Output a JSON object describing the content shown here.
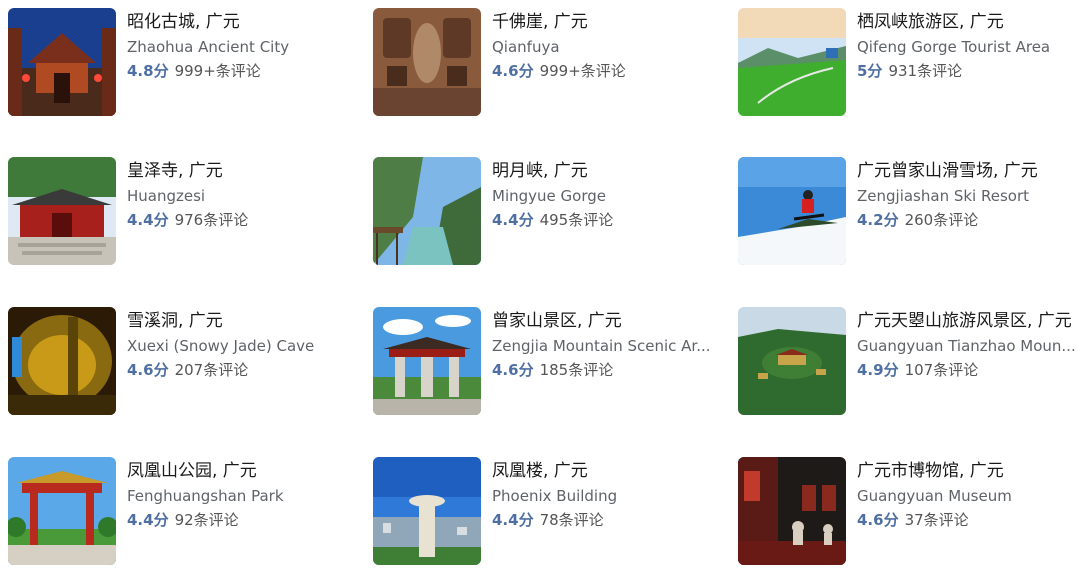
{
  "attractions": [
    {
      "title": "昭化古城, 广元",
      "subtitle": "Zhaohua Ancient City",
      "score": "4.8分",
      "reviews": "999+条评论",
      "thumb_icon": "ancient-city-photo-icon"
    },
    {
      "title": "千佛崖, 广元",
      "subtitle": "Qianfuya",
      "score": "4.6分",
      "reviews": "999+条评论",
      "thumb_icon": "cliff-carving-photo-icon"
    },
    {
      "title": "栖凤峡旅游区, 广元",
      "subtitle": "Qifeng Gorge Tourist Area",
      "score": "5分",
      "reviews": "931条评论",
      "thumb_icon": "gorge-meadow-photo-icon"
    },
    {
      "title": "皇泽寺, 广元",
      "subtitle": "Huangzesi",
      "score": "4.4分",
      "reviews": "976条评论",
      "thumb_icon": "temple-photo-icon"
    },
    {
      "title": "明月峡, 广元",
      "subtitle": "Mingyue Gorge",
      "score": "4.4分",
      "reviews": "495条评论",
      "thumb_icon": "river-gorge-photo-icon"
    },
    {
      "title": "广元曾家山滑雪场, 广元",
      "subtitle": "Zengjiashan Ski Resort",
      "score": "4.2分",
      "reviews": "260条评论",
      "thumb_icon": "skier-photo-icon"
    },
    {
      "title": "雪溪洞, 广元",
      "subtitle": "Xuexi (Snowy Jade) Cave",
      "score": "4.6分",
      "reviews": "207条评论",
      "thumb_icon": "cave-photo-icon"
    },
    {
      "title": "曾家山景区, 广元",
      "subtitle": "Zengjia Mountain Scenic Ar...",
      "score": "4.6分",
      "reviews": "185条评论",
      "thumb_icon": "gate-arch-photo-icon"
    },
    {
      "title": "广元天曌山旅游风景区, 广元",
      "subtitle": "Guangyuan Tianzhao Moun...",
      "score": "4.9分",
      "reviews": "107条评论",
      "thumb_icon": "mountain-temple-photo-icon"
    },
    {
      "title": "凤凰山公园, 广元",
      "subtitle": "Fenghuangshan Park",
      "score": "4.4分",
      "reviews": "92条评论",
      "thumb_icon": "park-gate-photo-icon"
    },
    {
      "title": "凤凰楼, 广元",
      "subtitle": "Phoenix Building",
      "score": "4.4分",
      "reviews": "78条评论",
      "thumb_icon": "tower-photo-icon"
    },
    {
      "title": "广元市博物馆, 广元",
      "subtitle": "Guangyuan Museum",
      "score": "4.6分",
      "reviews": "37条评论",
      "thumb_icon": "museum-photo-icon"
    }
  ],
  "colors": {
    "score": "#4f6fa3",
    "title": "#1a1a1a",
    "subtitle": "#5f6368"
  }
}
